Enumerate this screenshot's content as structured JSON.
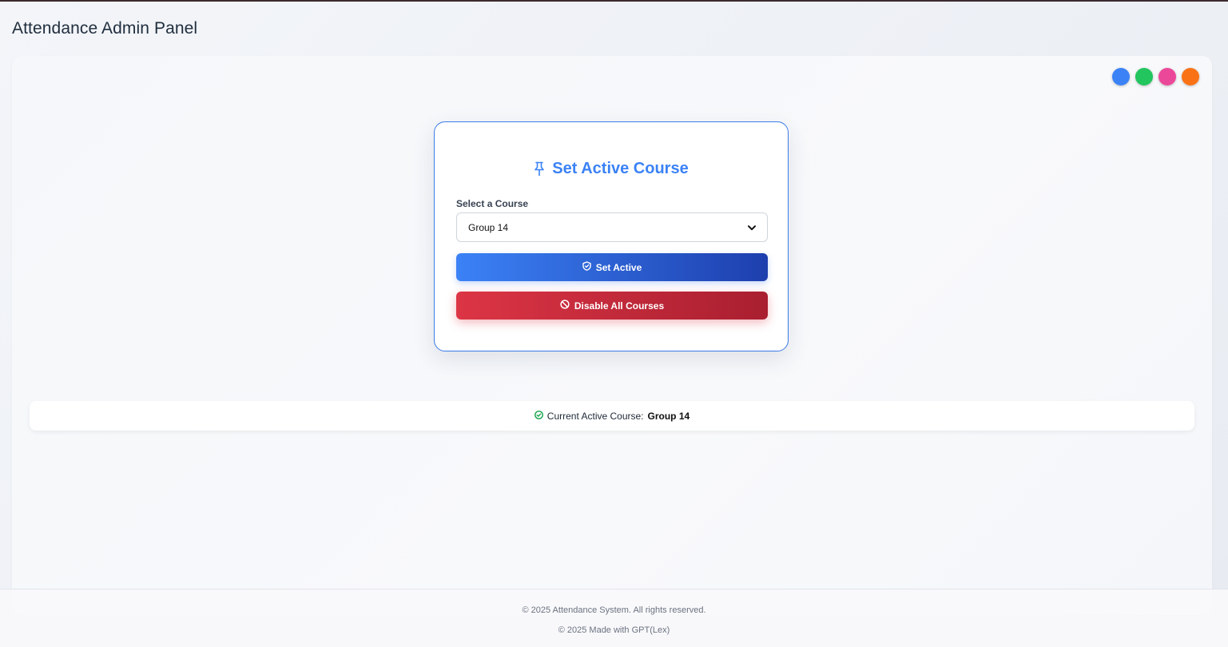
{
  "header": {
    "title": "Attendance Admin Panel"
  },
  "theme_switcher": {
    "colors": [
      "#3b82f6",
      "#22c55e",
      "#ec4899",
      "#f97316"
    ]
  },
  "card": {
    "title": "Set Active Course",
    "select_label": "Select a Course",
    "selected_course": "Group 14",
    "set_active_label": "Set Active",
    "disable_all_label": "Disable All Courses"
  },
  "status": {
    "prefix": "Current Active Course:",
    "course": "Group 14"
  },
  "footer": {
    "line1": "© 2025 Attendance System. All rights reserved.",
    "line2": "© 2025 Made with GPT(Lex)"
  },
  "colors": {
    "accent": "#3b82f6",
    "danger": "#dc3545",
    "success": "#16a34a"
  }
}
